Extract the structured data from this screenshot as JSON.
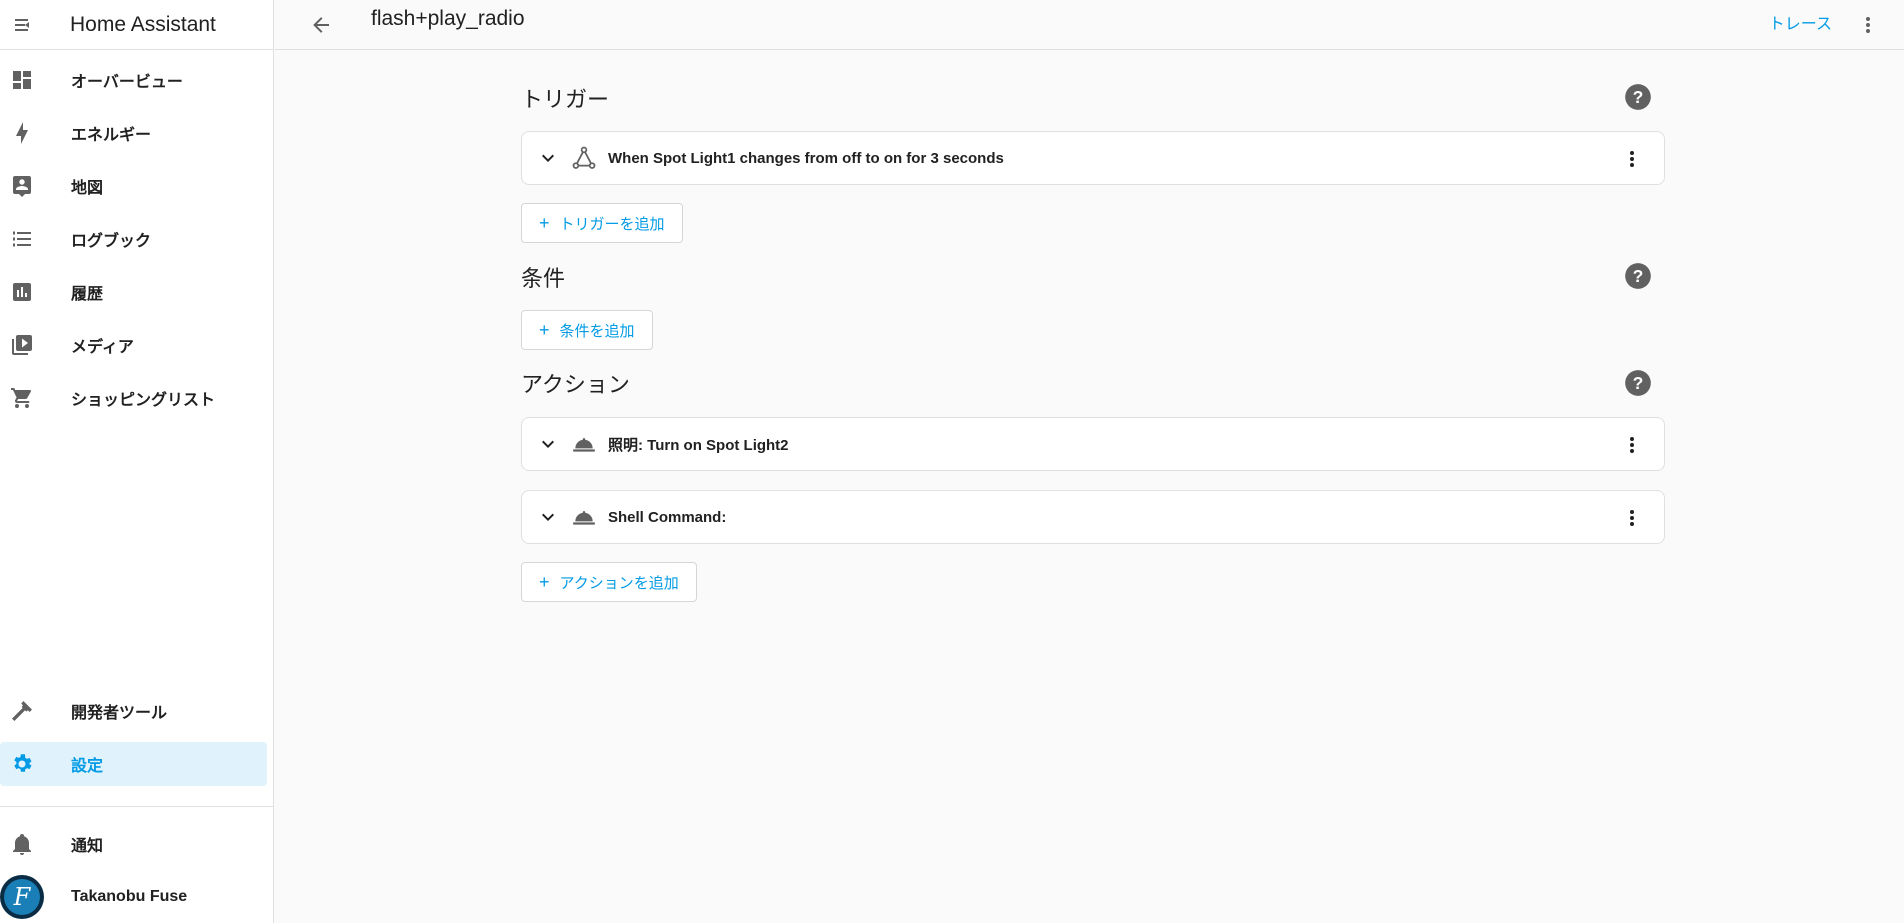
{
  "app": {
    "title": "Home Assistant"
  },
  "sidebar": {
    "items": [
      {
        "label": "オーバービュー",
        "icon": "dashboard-icon"
      },
      {
        "label": "エネルギー",
        "icon": "lightning-icon"
      },
      {
        "label": "地図",
        "icon": "map-person-icon"
      },
      {
        "label": "ログブック",
        "icon": "list-icon"
      },
      {
        "label": "履歴",
        "icon": "chart-box-icon"
      },
      {
        "label": "メディア",
        "icon": "media-icon"
      },
      {
        "label": "ショッピングリスト",
        "icon": "cart-icon"
      }
    ],
    "bottom_items": [
      {
        "label": "開発者ツール",
        "icon": "hammer-icon"
      },
      {
        "label": "設定",
        "icon": "gear-icon"
      }
    ],
    "notifications_label": "通知",
    "user": {
      "name": "Takanobu Fuse",
      "avatar_letter": "F"
    }
  },
  "topbar": {
    "title": "flash+play_radio",
    "trace_label": "トレース"
  },
  "triggers": {
    "title": "トリガー",
    "items": [
      {
        "text": "When Spot Light1 changes from off to on for 3 seconds",
        "icon": "state-change-icon"
      }
    ],
    "add_label": "トリガーを追加"
  },
  "conditions": {
    "title": "条件",
    "add_label": "条件を追加"
  },
  "actions": {
    "title": "アクション",
    "items": [
      {
        "text": "照明: Turn on Spot Light2",
        "icon": "service-bell-icon"
      },
      {
        "text": "Shell Command:",
        "icon": "service-bell-icon"
      }
    ],
    "add_label": "アクションを追加"
  },
  "colors": {
    "accent": "#039be5",
    "active_bg": "#e0f2fb",
    "icon": "#616161"
  }
}
